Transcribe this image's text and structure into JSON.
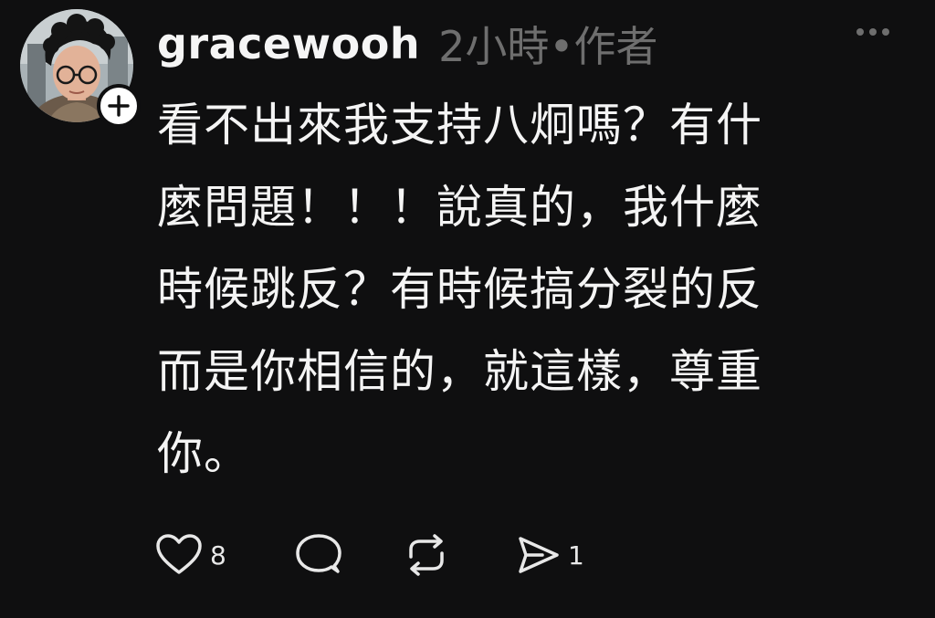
{
  "post": {
    "username": "gracewooh",
    "time": "2小時",
    "separator": "•",
    "role": "作者",
    "body": "看不出來我支持八炯嗎？有什\n麼問題！！！說真的，我什麼\n時候跳反？有時候搞分裂的反\n而是你相信的，就這樣，尊重\n你。",
    "likes": "8",
    "shares": "1"
  },
  "icons": {
    "more": "more-horizontal-icon",
    "follow": "plus-icon",
    "like": "heart-icon",
    "comment": "comment-bubble-icon",
    "repost": "repost-icon",
    "share": "send-icon"
  },
  "colors": {
    "background": "#0f0f10",
    "text": "#f4f4f4",
    "muted": "#6e6e6e",
    "badge": "#ffffff"
  }
}
